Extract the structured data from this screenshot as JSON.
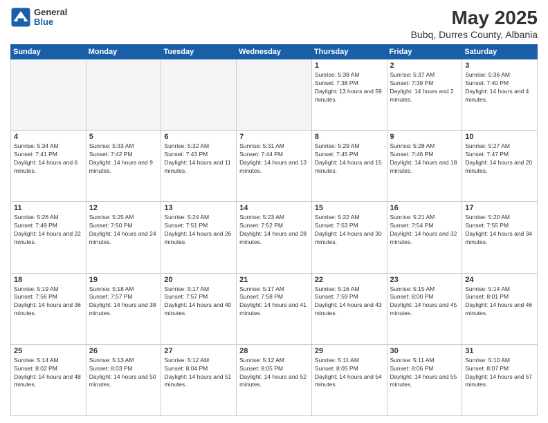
{
  "logo": {
    "general": "General",
    "blue": "Blue"
  },
  "header": {
    "title": "May 2025",
    "subtitle": "Bubq, Durres County, Albania"
  },
  "days_of_week": [
    "Sunday",
    "Monday",
    "Tuesday",
    "Wednesday",
    "Thursday",
    "Friday",
    "Saturday"
  ],
  "weeks": [
    [
      {
        "num": "",
        "sunrise": "",
        "sunset": "",
        "daylight": "",
        "empty": true
      },
      {
        "num": "",
        "sunrise": "",
        "sunset": "",
        "daylight": "",
        "empty": true
      },
      {
        "num": "",
        "sunrise": "",
        "sunset": "",
        "daylight": "",
        "empty": true
      },
      {
        "num": "",
        "sunrise": "",
        "sunset": "",
        "daylight": "",
        "empty": true
      },
      {
        "num": "1",
        "sunrise": "Sunrise: 5:38 AM",
        "sunset": "Sunset: 7:38 PM",
        "daylight": "Daylight: 13 hours and 59 minutes.",
        "empty": false
      },
      {
        "num": "2",
        "sunrise": "Sunrise: 5:37 AM",
        "sunset": "Sunset: 7:39 PM",
        "daylight": "Daylight: 14 hours and 2 minutes.",
        "empty": false
      },
      {
        "num": "3",
        "sunrise": "Sunrise: 5:36 AM",
        "sunset": "Sunset: 7:40 PM",
        "daylight": "Daylight: 14 hours and 4 minutes.",
        "empty": false
      }
    ],
    [
      {
        "num": "4",
        "sunrise": "Sunrise: 5:34 AM",
        "sunset": "Sunset: 7:41 PM",
        "daylight": "Daylight: 14 hours and 6 minutes.",
        "empty": false
      },
      {
        "num": "5",
        "sunrise": "Sunrise: 5:33 AM",
        "sunset": "Sunset: 7:42 PM",
        "daylight": "Daylight: 14 hours and 9 minutes.",
        "empty": false
      },
      {
        "num": "6",
        "sunrise": "Sunrise: 5:32 AM",
        "sunset": "Sunset: 7:43 PM",
        "daylight": "Daylight: 14 hours and 11 minutes.",
        "empty": false
      },
      {
        "num": "7",
        "sunrise": "Sunrise: 5:31 AM",
        "sunset": "Sunset: 7:44 PM",
        "daylight": "Daylight: 14 hours and 13 minutes.",
        "empty": false
      },
      {
        "num": "8",
        "sunrise": "Sunrise: 5:29 AM",
        "sunset": "Sunset: 7:45 PM",
        "daylight": "Daylight: 14 hours and 15 minutes.",
        "empty": false
      },
      {
        "num": "9",
        "sunrise": "Sunrise: 5:28 AM",
        "sunset": "Sunset: 7:46 PM",
        "daylight": "Daylight: 14 hours and 18 minutes.",
        "empty": false
      },
      {
        "num": "10",
        "sunrise": "Sunrise: 5:27 AM",
        "sunset": "Sunset: 7:47 PM",
        "daylight": "Daylight: 14 hours and 20 minutes.",
        "empty": false
      }
    ],
    [
      {
        "num": "11",
        "sunrise": "Sunrise: 5:26 AM",
        "sunset": "Sunset: 7:49 PM",
        "daylight": "Daylight: 14 hours and 22 minutes.",
        "empty": false
      },
      {
        "num": "12",
        "sunrise": "Sunrise: 5:25 AM",
        "sunset": "Sunset: 7:50 PM",
        "daylight": "Daylight: 14 hours and 24 minutes.",
        "empty": false
      },
      {
        "num": "13",
        "sunrise": "Sunrise: 5:24 AM",
        "sunset": "Sunset: 7:51 PM",
        "daylight": "Daylight: 14 hours and 26 minutes.",
        "empty": false
      },
      {
        "num": "14",
        "sunrise": "Sunrise: 5:23 AM",
        "sunset": "Sunset: 7:52 PM",
        "daylight": "Daylight: 14 hours and 28 minutes.",
        "empty": false
      },
      {
        "num": "15",
        "sunrise": "Sunrise: 5:22 AM",
        "sunset": "Sunset: 7:53 PM",
        "daylight": "Daylight: 14 hours and 30 minutes.",
        "empty": false
      },
      {
        "num": "16",
        "sunrise": "Sunrise: 5:21 AM",
        "sunset": "Sunset: 7:54 PM",
        "daylight": "Daylight: 14 hours and 32 minutes.",
        "empty": false
      },
      {
        "num": "17",
        "sunrise": "Sunrise: 5:20 AM",
        "sunset": "Sunset: 7:55 PM",
        "daylight": "Daylight: 14 hours and 34 minutes.",
        "empty": false
      }
    ],
    [
      {
        "num": "18",
        "sunrise": "Sunrise: 5:19 AM",
        "sunset": "Sunset: 7:56 PM",
        "daylight": "Daylight: 14 hours and 36 minutes.",
        "empty": false
      },
      {
        "num": "19",
        "sunrise": "Sunrise: 5:18 AM",
        "sunset": "Sunset: 7:57 PM",
        "daylight": "Daylight: 14 hours and 38 minutes.",
        "empty": false
      },
      {
        "num": "20",
        "sunrise": "Sunrise: 5:17 AM",
        "sunset": "Sunset: 7:57 PM",
        "daylight": "Daylight: 14 hours and 40 minutes.",
        "empty": false
      },
      {
        "num": "21",
        "sunrise": "Sunrise: 5:17 AM",
        "sunset": "Sunset: 7:58 PM",
        "daylight": "Daylight: 14 hours and 41 minutes.",
        "empty": false
      },
      {
        "num": "22",
        "sunrise": "Sunrise: 5:16 AM",
        "sunset": "Sunset: 7:59 PM",
        "daylight": "Daylight: 14 hours and 43 minutes.",
        "empty": false
      },
      {
        "num": "23",
        "sunrise": "Sunrise: 5:15 AM",
        "sunset": "Sunset: 8:00 PM",
        "daylight": "Daylight: 14 hours and 45 minutes.",
        "empty": false
      },
      {
        "num": "24",
        "sunrise": "Sunrise: 5:14 AM",
        "sunset": "Sunset: 8:01 PM",
        "daylight": "Daylight: 14 hours and 46 minutes.",
        "empty": false
      }
    ],
    [
      {
        "num": "25",
        "sunrise": "Sunrise: 5:14 AM",
        "sunset": "Sunset: 8:02 PM",
        "daylight": "Daylight: 14 hours and 48 minutes.",
        "empty": false
      },
      {
        "num": "26",
        "sunrise": "Sunrise: 5:13 AM",
        "sunset": "Sunset: 8:03 PM",
        "daylight": "Daylight: 14 hours and 50 minutes.",
        "empty": false
      },
      {
        "num": "27",
        "sunrise": "Sunrise: 5:12 AM",
        "sunset": "Sunset: 8:04 PM",
        "daylight": "Daylight: 14 hours and 51 minutes.",
        "empty": false
      },
      {
        "num": "28",
        "sunrise": "Sunrise: 5:12 AM",
        "sunset": "Sunset: 8:05 PM",
        "daylight": "Daylight: 14 hours and 52 minutes.",
        "empty": false
      },
      {
        "num": "29",
        "sunrise": "Sunrise: 5:11 AM",
        "sunset": "Sunset: 8:05 PM",
        "daylight": "Daylight: 14 hours and 54 minutes.",
        "empty": false
      },
      {
        "num": "30",
        "sunrise": "Sunrise: 5:11 AM",
        "sunset": "Sunset: 8:06 PM",
        "daylight": "Daylight: 14 hours and 55 minutes.",
        "empty": false
      },
      {
        "num": "31",
        "sunrise": "Sunrise: 5:10 AM",
        "sunset": "Sunset: 8:07 PM",
        "daylight": "Daylight: 14 hours and 57 minutes.",
        "empty": false
      }
    ]
  ]
}
